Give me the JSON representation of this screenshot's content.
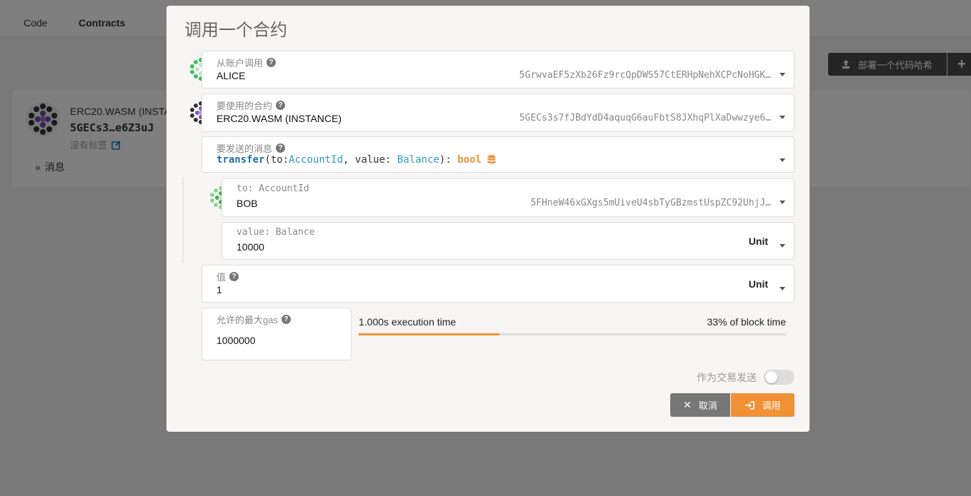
{
  "nav": {
    "tabs": [
      "Code",
      "Contracts"
    ]
  },
  "actions": {
    "deploy_label": "部署一个代码哈希",
    "add_label": "+"
  },
  "contract_card": {
    "name": "ERC20.WASM (INSTA",
    "address": "5GECs3…e6Z3uJ",
    "tags_label": "没有标签",
    "messages_label": "消息"
  },
  "modal": {
    "title": "调用一个合约",
    "account": {
      "label": "从账户调用",
      "name": "ALICE",
      "address": "5GrwvaEF5zXb26Fz9rcQpDWS57CtERHpNehXCPcNoHGK…"
    },
    "contract": {
      "label": "要使用的合约",
      "name": "ERC20.WASM (INSTANCE)",
      "address": "5GECs3s7fJBdYdD4aquqG6auFbtS8JXhqPlXaDwwzye6…"
    },
    "message": {
      "label": "要发送的消息",
      "method": "transfer",
      "open_paren": "(",
      "arg1_name": "to: ",
      "arg1_type": "AccountId",
      "separator": ", ",
      "arg2_name": "value: ",
      "arg2_type": "Balance",
      "close": "): ",
      "returns": "bool"
    },
    "param_to": {
      "label": "to: AccountId",
      "name": "BOB",
      "address": "5FHneW46xGXgs5mUiveU4sbTyGBzmstUspZC92UhjJ…"
    },
    "param_value": {
      "label": "value: Balance",
      "value": "10000",
      "unit": "Unit"
    },
    "value": {
      "label": "值",
      "value": "1",
      "unit": "Unit"
    },
    "gas": {
      "label": "允许的最大gas",
      "value": "1000000",
      "execution_time": "1.000s execution time",
      "block_time": "33% of block time",
      "block_fraction": 0.33
    },
    "send_as_tx": {
      "label": "作为交易发送",
      "enabled": false
    },
    "buttons": {
      "cancel": "取消",
      "call": "调用"
    }
  },
  "colors": {
    "accent": "#f19135",
    "method": "#1f6fa6",
    "type": "#2aa0b8"
  }
}
